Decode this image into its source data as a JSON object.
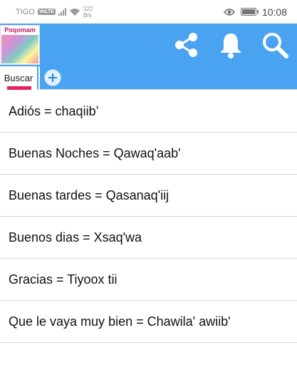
{
  "statusbar": {
    "carrier": "TIGO",
    "volte": "VoLTE",
    "speed_value": "122",
    "speed_unit": "B/s",
    "time": "10:08"
  },
  "appbar": {
    "logo_text": "Poqomam",
    "icons": [
      "share-icon",
      "bell-icon",
      "search-icon"
    ]
  },
  "tabs": {
    "search_label": "Buscar",
    "add_icon": "plus-icon"
  },
  "phrases": [
    "Adiós = chaqiib’",
    "Buenas Noches = Qawaq'aab'",
    "Buenas tardes = Qasanaq'iij",
    "Buenos dias = Xsaq'wa",
    "Gracias = Tiyoox tii",
    "Que le vaya muy bien = Chawila' awiib'"
  ],
  "colors": {
    "appbar": "#4aa3f0",
    "tab_indicator": "#e91e63"
  }
}
